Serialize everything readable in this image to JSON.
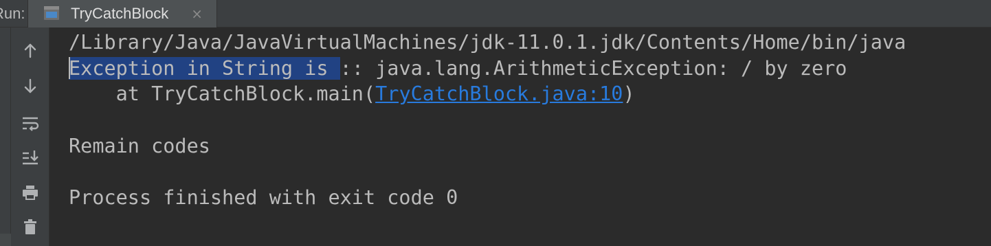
{
  "header": {
    "run_label": "Run:",
    "tab_title": "TryCatchBlock",
    "tab_close_glyph": "×"
  },
  "toolbar": {
    "buttons": [
      {
        "icon": "up-arrow-icon"
      },
      {
        "icon": "down-arrow-icon"
      },
      {
        "icon": "soft-wrap-icon"
      },
      {
        "icon": "scroll-to-end-icon"
      },
      {
        "icon": "print-icon"
      },
      {
        "icon": "trash-icon"
      }
    ]
  },
  "console": {
    "line1": "/Library/Java/JavaVirtualMachines/jdk-11.0.1.jdk/Contents/Home/bin/java",
    "line2_selected": "Exception in String is ",
    "line2_rest": ":: java.lang.ArithmeticException: / by zero",
    "line3_prefix": "    at TryCatchBlock.main(",
    "line3_link": "TryCatchBlock.java:10",
    "line3_suffix": ")",
    "line5": "Remain codes",
    "line7": "Process finished with exit code 0"
  },
  "colors": {
    "background": "#2b2b2b",
    "text": "#bbbbbb",
    "selection": "#214283",
    "link": "#287bde",
    "toolbar": "#3c3f41"
  }
}
